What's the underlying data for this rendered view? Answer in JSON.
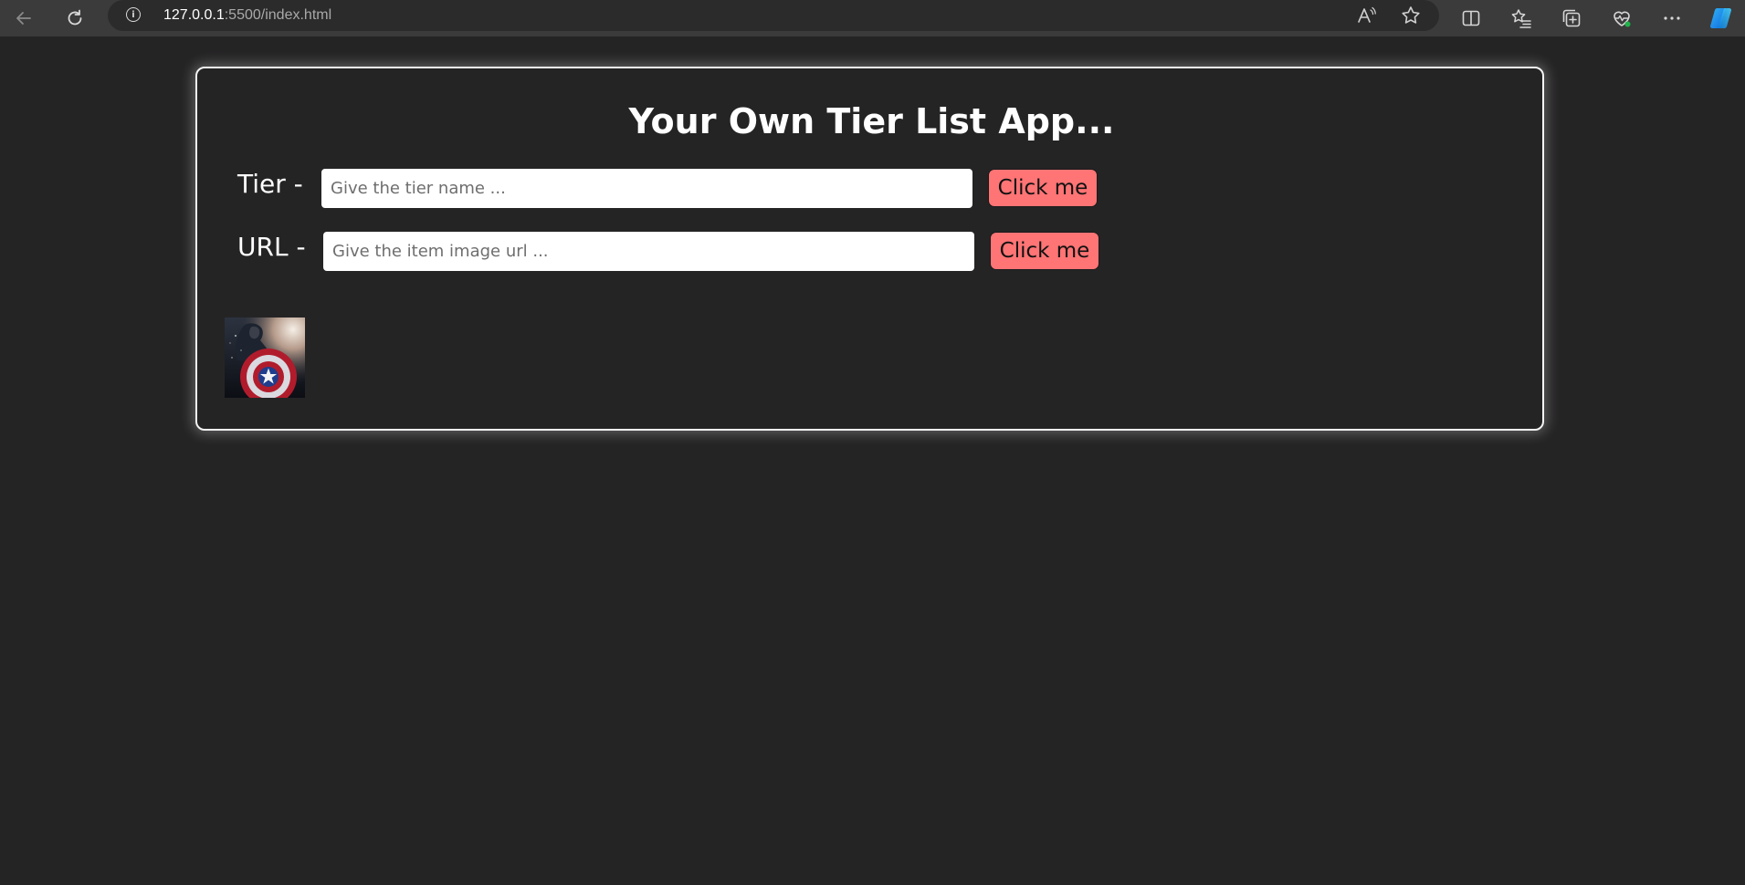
{
  "browser": {
    "url_host": "127.0.0.1",
    "url_path": ":5500/index.html"
  },
  "app": {
    "title": "Your Own Tier List App...",
    "tier_row": {
      "label": "Tier -",
      "placeholder": "Give the tier name ...",
      "value": "",
      "button_label": "Click me"
    },
    "url_row": {
      "label": "URL -",
      "placeholder": "Give the item image url ...",
      "value": "",
      "button_label": "Click me"
    },
    "items": [
      {
        "kind": "image",
        "subject": "captain-america-shield"
      }
    ]
  },
  "colors": {
    "page_bg": "#252425",
    "chrome_bg": "#3b3b3b",
    "button_bg": "#ff7475",
    "card_border": "#f4f4f4"
  }
}
